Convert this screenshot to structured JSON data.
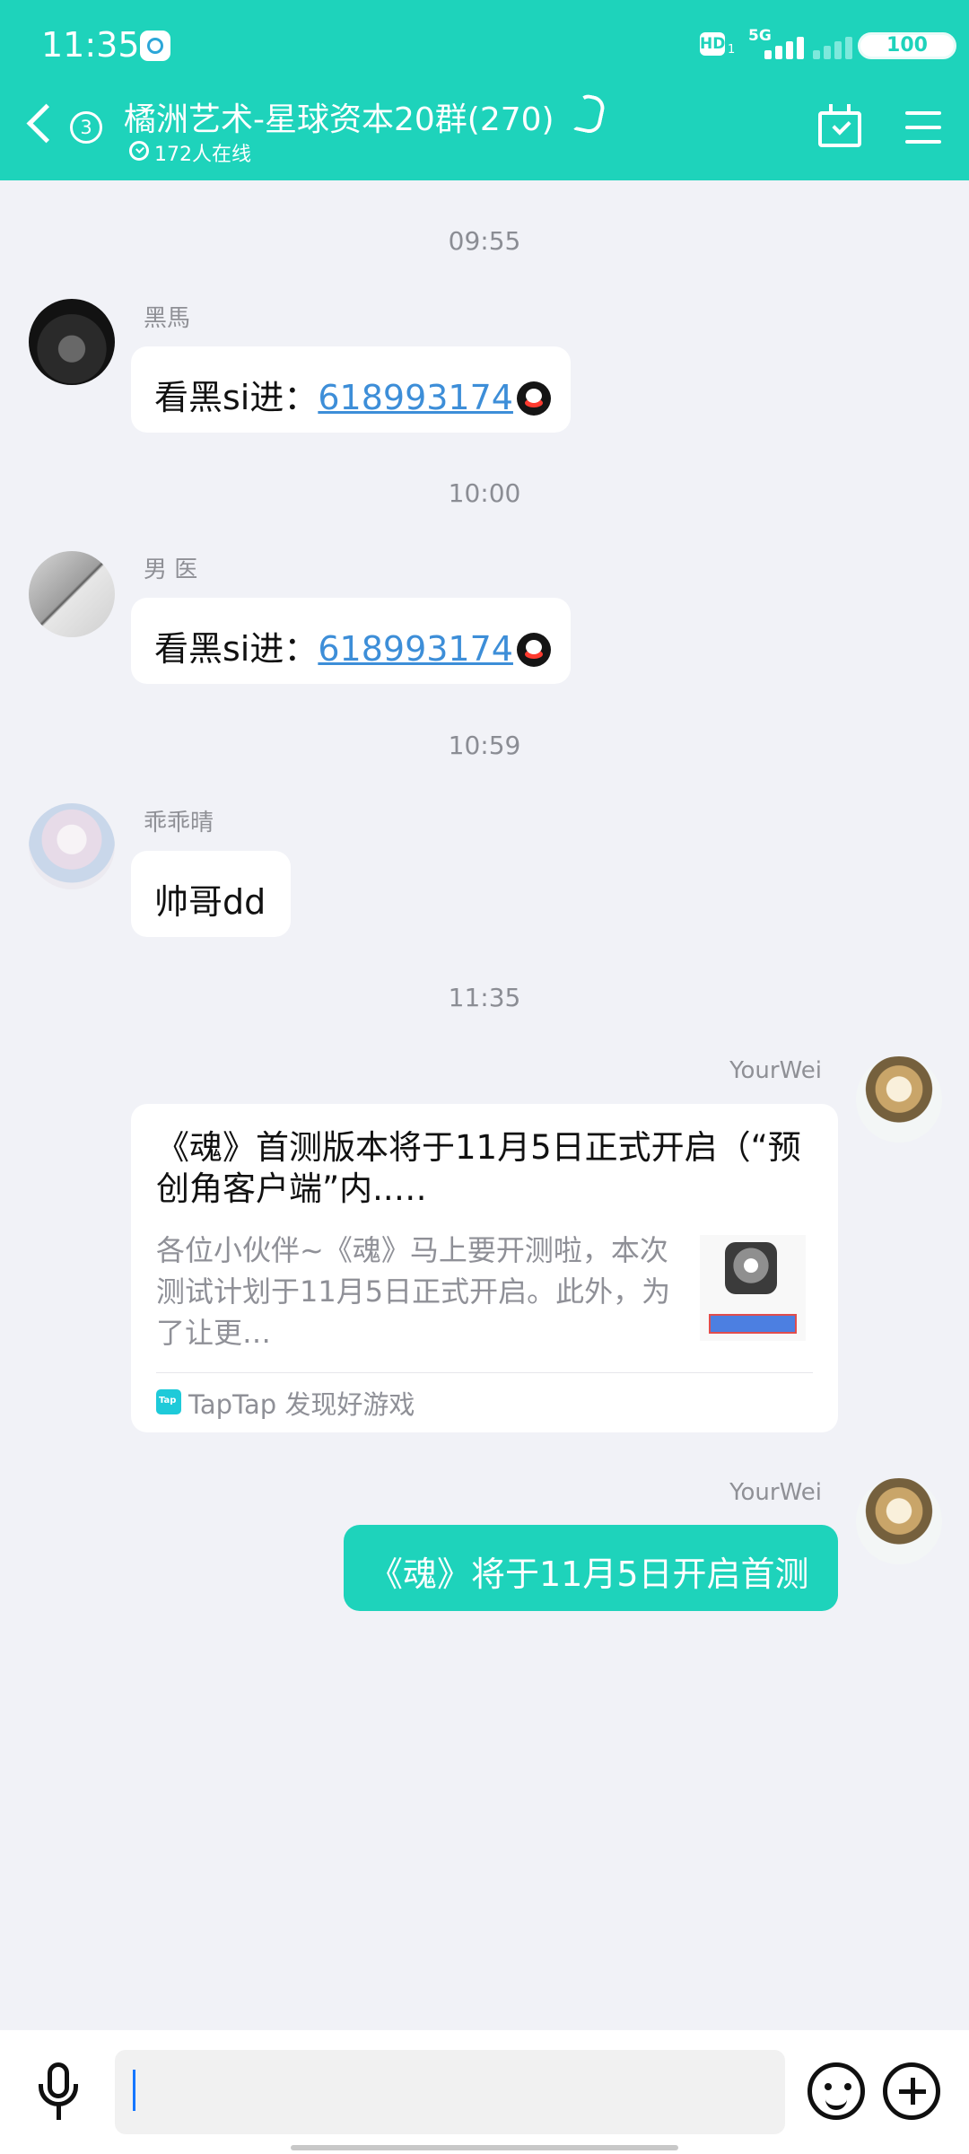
{
  "status_bar": {
    "time": "11:35",
    "network": "5G",
    "hd": "HD",
    "hd_sub": "1",
    "battery": "100"
  },
  "header": {
    "back_badge": "3",
    "title": "橘洲艺术-星球资本20群(270)",
    "online": "172人在线"
  },
  "messages": [
    {
      "type": "time",
      "time": "09:55"
    },
    {
      "type": "incoming",
      "sender": "黑馬",
      "text": "看黑si进：",
      "link": "618993174",
      "icon": "qq-sticker-icon"
    },
    {
      "type": "time",
      "time": "10:00"
    },
    {
      "type": "incoming",
      "sender": "男 医",
      "text": "看黑si进：",
      "link": "618993174",
      "icon": "qq-penguin-icon"
    },
    {
      "type": "time",
      "time": "10:59"
    },
    {
      "type": "incoming",
      "sender": "乖乖晴",
      "text": "帅哥dd"
    },
    {
      "type": "time",
      "time": "11:35"
    },
    {
      "type": "outgoing-card",
      "sender": "YourWei",
      "title": "《魂》首测版本将于11月5日正式开启（“预创角客户端”内..…",
      "summary": "各位小伙伴~《魂》马上要开测啦，本次测试计划于11月5日正式开启。此外，为了让更…",
      "source": "TapTap 发现好游戏"
    },
    {
      "type": "outgoing",
      "sender": "YourWei",
      "text": "《魂》将于11月5日开启首测"
    }
  ],
  "colors": {
    "accent": "#1ed3bb",
    "background": "#f1f2f7",
    "link": "#3d8ed8"
  }
}
